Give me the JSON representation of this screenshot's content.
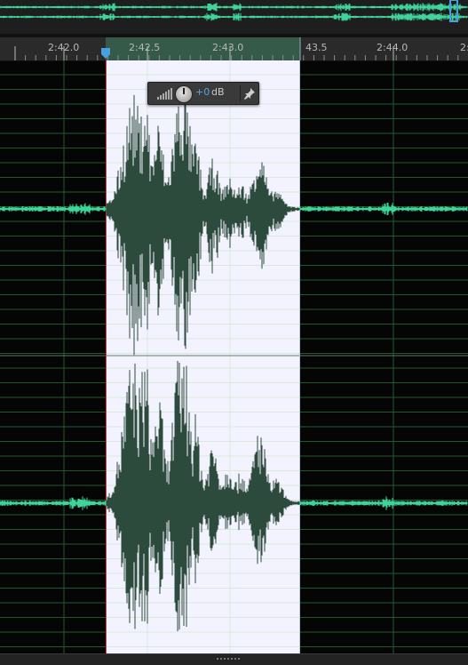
{
  "ruler": {
    "ticks": [
      {
        "label": "2:42.0"
      },
      {
        "label": "2:42.5"
      },
      {
        "label": "2:43.0"
      },
      {
        "label": "43.5"
      },
      {
        "label": "2:44.0"
      },
      {
        "label": "2:"
      }
    ]
  },
  "hud": {
    "value": "+0",
    "unit": "dB"
  },
  "colors": {
    "waveform": "#3ed49a",
    "selection_bg": "#f3f3ff",
    "selected_wave": "#2c4b3c",
    "grid": "#1f5a2e",
    "accent": "#58a6e0"
  },
  "icons": {
    "playhead": "playhead-marker-icon",
    "meter": "level-meter-icon",
    "knob": "volume-knob-icon",
    "pin": "pin-icon",
    "grip": "grip-icon"
  }
}
